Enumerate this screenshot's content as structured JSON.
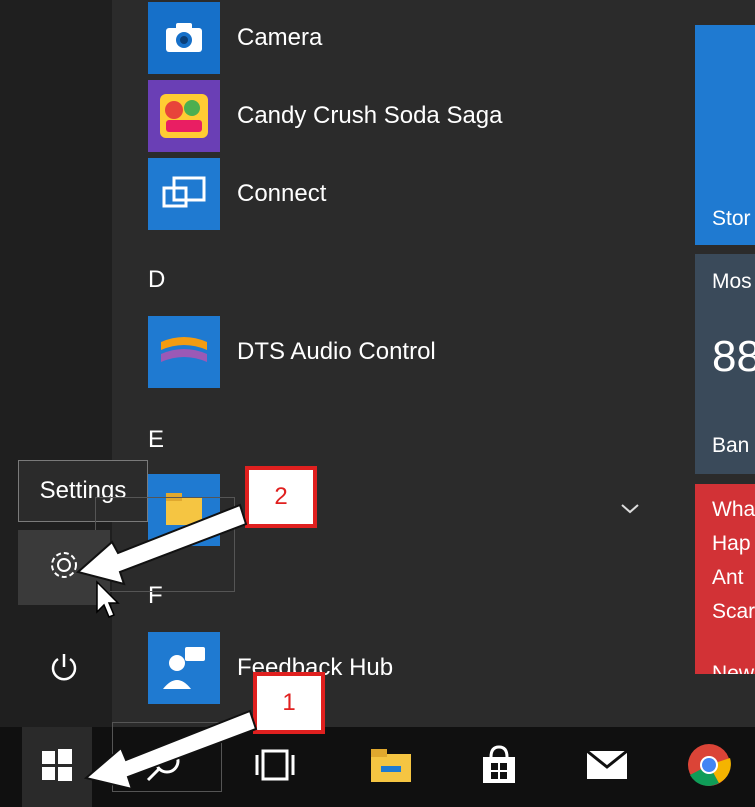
{
  "app_list": {
    "items": [
      {
        "label": "Camera",
        "icon": "camera-icon"
      },
      {
        "label": "Candy Crush Soda Saga",
        "icon": "candy-crush-icon"
      },
      {
        "label": "Connect",
        "icon": "connect-icon"
      },
      {
        "label": "DTS Audio Control",
        "icon": "dts-audio-icon"
      },
      {
        "label": "",
        "icon": "file-explorer-icon"
      },
      {
        "label": "Feedback Hub",
        "icon": "feedback-hub-icon"
      }
    ],
    "letters": [
      "D",
      "E",
      "F"
    ]
  },
  "tiles": {
    "store": "Stor",
    "weather_header": "Mos",
    "weather_temp": "88",
    "weather_city": "Ban",
    "news_lines": [
      "Wha",
      "Hap",
      "Ant",
      "Scar"
    ],
    "news_footer": "New"
  },
  "sidebar": {
    "tooltip": "Settings",
    "settings_icon": "gear-icon",
    "power_icon": "power-icon"
  },
  "annotations": {
    "badge_1": "1",
    "badge_2": "2"
  },
  "taskbar": {
    "items": [
      "start-icon",
      "search-icon",
      "task-view-icon",
      "file-explorer-icon",
      "store-icon",
      "mail-icon",
      "chrome-icon"
    ]
  },
  "colors": {
    "accent_blue": "#1f7ad1",
    "news_red": "#d23236",
    "badge_red": "#e0201f"
  }
}
